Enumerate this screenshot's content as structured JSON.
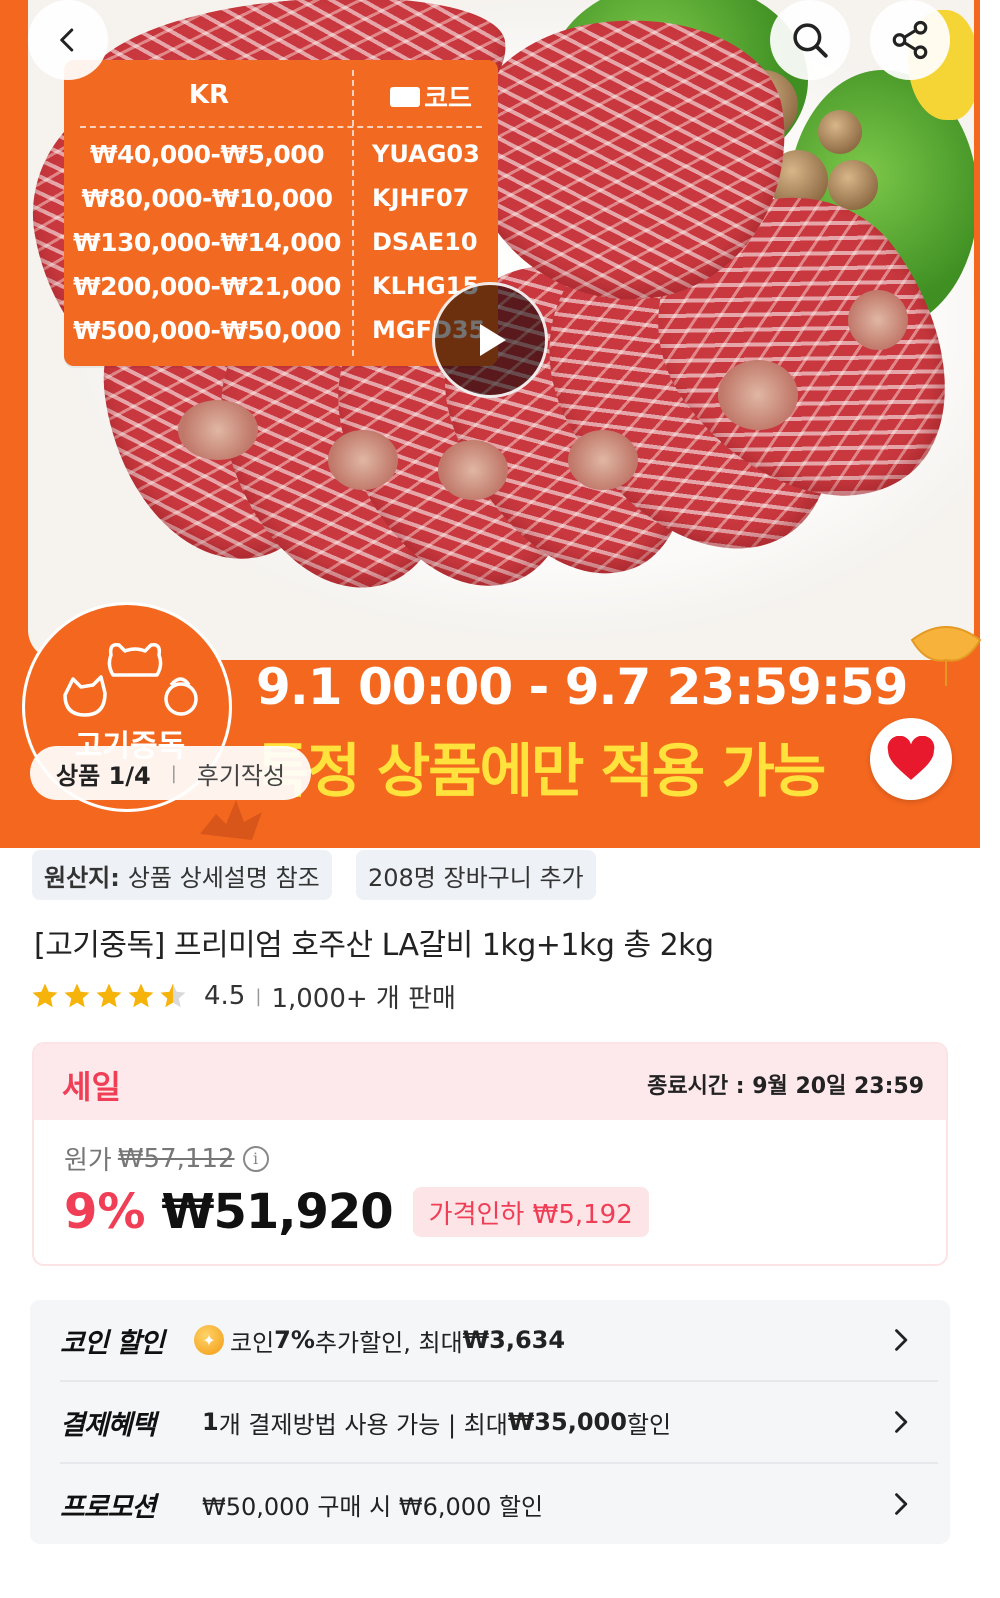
{
  "hero": {
    "coupon": {
      "col_region": "KR",
      "col_code": "코드",
      "rows": [
        {
          "range": "₩40,000-₩5,000",
          "code": "YUAG03"
        },
        {
          "range": "₩80,000-₩10,000",
          "code": "KJHF07"
        },
        {
          "range": "₩130,000-₩14,000",
          "code": "DSAE10"
        },
        {
          "range": "₩200,000-₩21,000",
          "code": "KLHG15"
        },
        {
          "range": "₩500,000-₩50,000",
          "code": "MGFD35"
        }
      ]
    },
    "brand": "고기중독",
    "promo_period": "9.1 00:00 - 9.7 23:59:59",
    "promo_note": "특정 상품에만 적용 가능",
    "image_counter": "상품 1/4",
    "review_link": "후기작성"
  },
  "product": {
    "origin_label": "원산지:",
    "origin_value": "상품 상세설명 참조",
    "cart_count": "208명 장바구니 추가",
    "title": "[고기중독] 프리미엄 호주산 LA갈비 1kg+1kg 총 2kg",
    "rating": 4.5,
    "rating_text": "4.5",
    "sold": "1,000+ 개 판매"
  },
  "price": {
    "sale_label": "세일",
    "end_time": "종료시간 : 9월 20일 23:59",
    "original_label": "원가",
    "original_price": "₩57,112",
    "discount_pct": "9%",
    "current_price": "₩51,920",
    "drop_label": "가격인하 ₩5,192"
  },
  "benefits": [
    {
      "label": "코인 할인",
      "text_pre": "코인 ",
      "text_bold": "7%",
      "text_mid": " 추가할인, 최대 ",
      "text_bold2": "₩3,634",
      "text_post": ""
    },
    {
      "label": "결제혜택",
      "text_pre": "",
      "text_bold": "1",
      "text_mid": "개 결제방법 사용 가능 | 최대 ",
      "text_bold2": "₩35,000",
      "text_post": " 할인"
    },
    {
      "label": "프로모션",
      "text_pre": "₩50,000 구매 시 ₩6,000 할인",
      "text_bold": "",
      "text_mid": "",
      "text_bold2": "",
      "text_post": ""
    }
  ],
  "colors": {
    "brand_orange": "#f4671f",
    "sale_red": "#ef3e55",
    "promo_yellow": "#ffe23c"
  }
}
